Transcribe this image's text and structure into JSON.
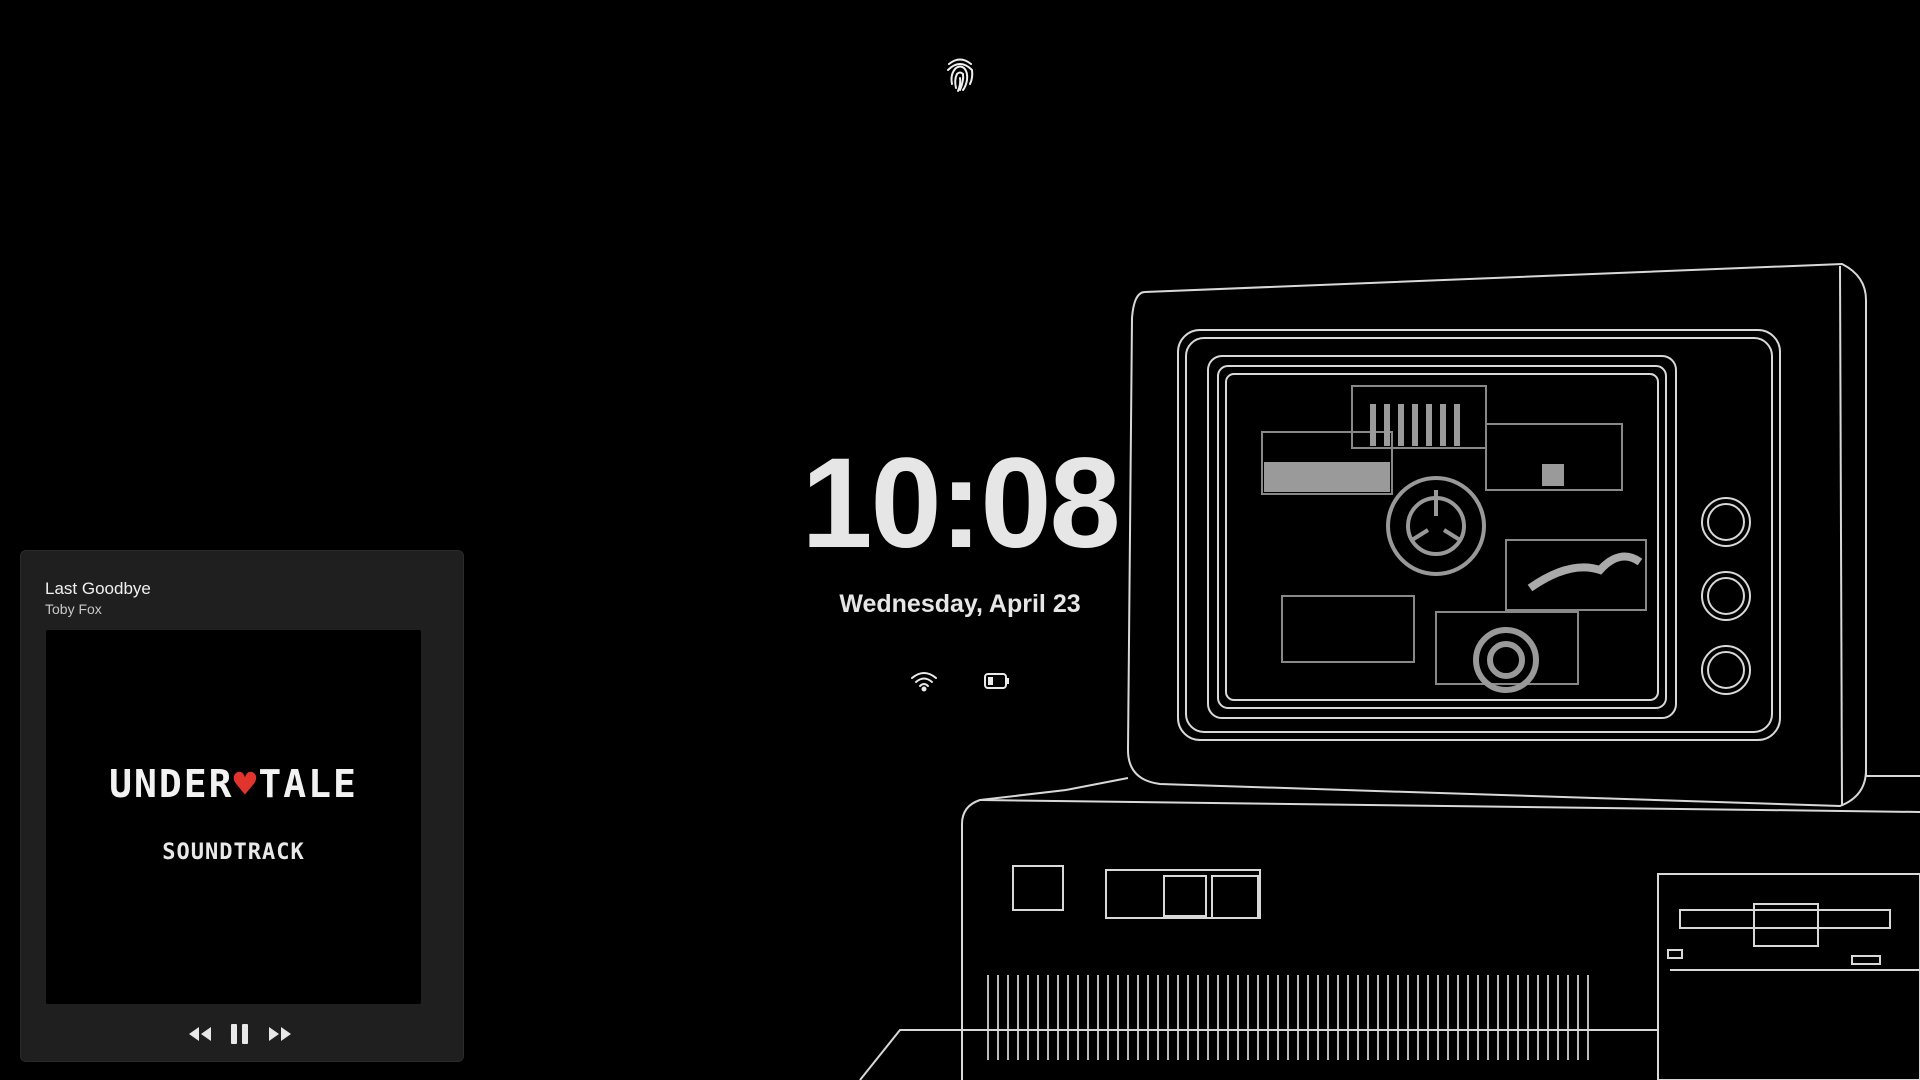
{
  "lockscreen": {
    "time": "10:08",
    "date": "Wednesday, April 23",
    "icons": {
      "fingerprint": "fingerprint-icon",
      "wifi": "wifi-icon",
      "battery": "battery-icon"
    }
  },
  "media": {
    "title": "Last Goodbye",
    "artist": "Toby Fox",
    "album_art": {
      "logo_pre": "UNDER",
      "logo_heart": "♥",
      "logo_post": "TALE",
      "subtitle": "SOUNDTRACK"
    },
    "controls": [
      "previous-icon",
      "pause-icon",
      "next-icon"
    ]
  },
  "colors": {
    "background": "#000000",
    "card": "#1f1f1f",
    "text": "#e6e6e6",
    "heart": "#e0342c"
  }
}
